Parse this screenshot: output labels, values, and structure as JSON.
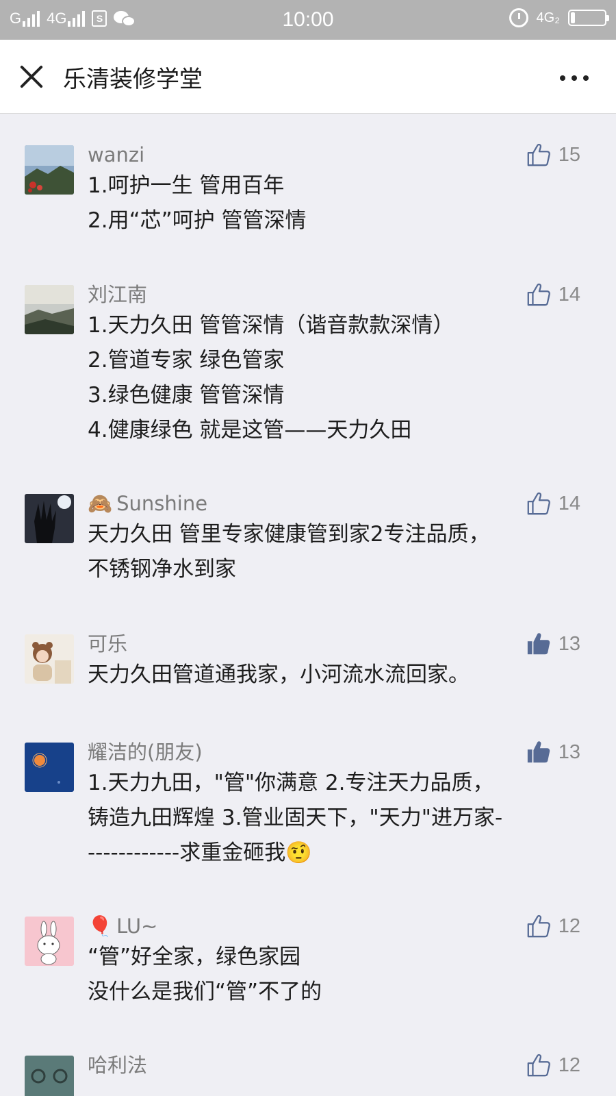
{
  "status_bar": {
    "carrier1": "G",
    "carrier2": "4G",
    "sim_label": "S",
    "time": "10:00",
    "network_right": "4G₂"
  },
  "nav": {
    "title": "乐清装修学堂"
  },
  "colors": {
    "like_active": "#576b95",
    "like_inactive": "#576b95",
    "name_gray": "#7b7b7b"
  },
  "comments": [
    {
      "name": "wanzi",
      "likes": "15",
      "liked": false,
      "lines": [
        "1.呵护一生  管用百年",
        "2.用“芯”呵护   管管深情"
      ]
    },
    {
      "name": "刘江南",
      "likes": "14",
      "liked": false,
      "lines": [
        "1.天力久田   管管深情（谐音款款深情）",
        "2.管道专家   绿色管家",
        "3.绿色健康     管管深情",
        "4.健康绿色  就是这管——天力久田"
      ]
    },
    {
      "name": "Sunshine",
      "name_emoji": "🙈",
      "likes": "14",
      "liked": false,
      "lines": [
        "天力久田 管里专家健康管到家2专注品质，",
        "不锈钢净水到家"
      ]
    },
    {
      "name": "可乐",
      "likes": "13",
      "liked": true,
      "lines": [
        "天力久田管道通我家，小河流水流回家。"
      ]
    },
    {
      "name": "耀洁的(朋友)",
      "likes": "13",
      "liked": true,
      "lines": [
        "1.天力九田，\"管\"你满意  2.专注天力品质，",
        "铸造九田辉煌 3.管业固天下，\"天力\"进万家-",
        "------------求重金砸我🤨"
      ]
    },
    {
      "name": "LU~",
      "name_emoji": "🎈",
      "likes": "12",
      "liked": false,
      "lines": [
        "“管”好全家，绿色家园",
        "没什么是我们“管”不了的"
      ]
    },
    {
      "name": "哈利法",
      "likes": "12",
      "liked": false,
      "lines": []
    }
  ]
}
